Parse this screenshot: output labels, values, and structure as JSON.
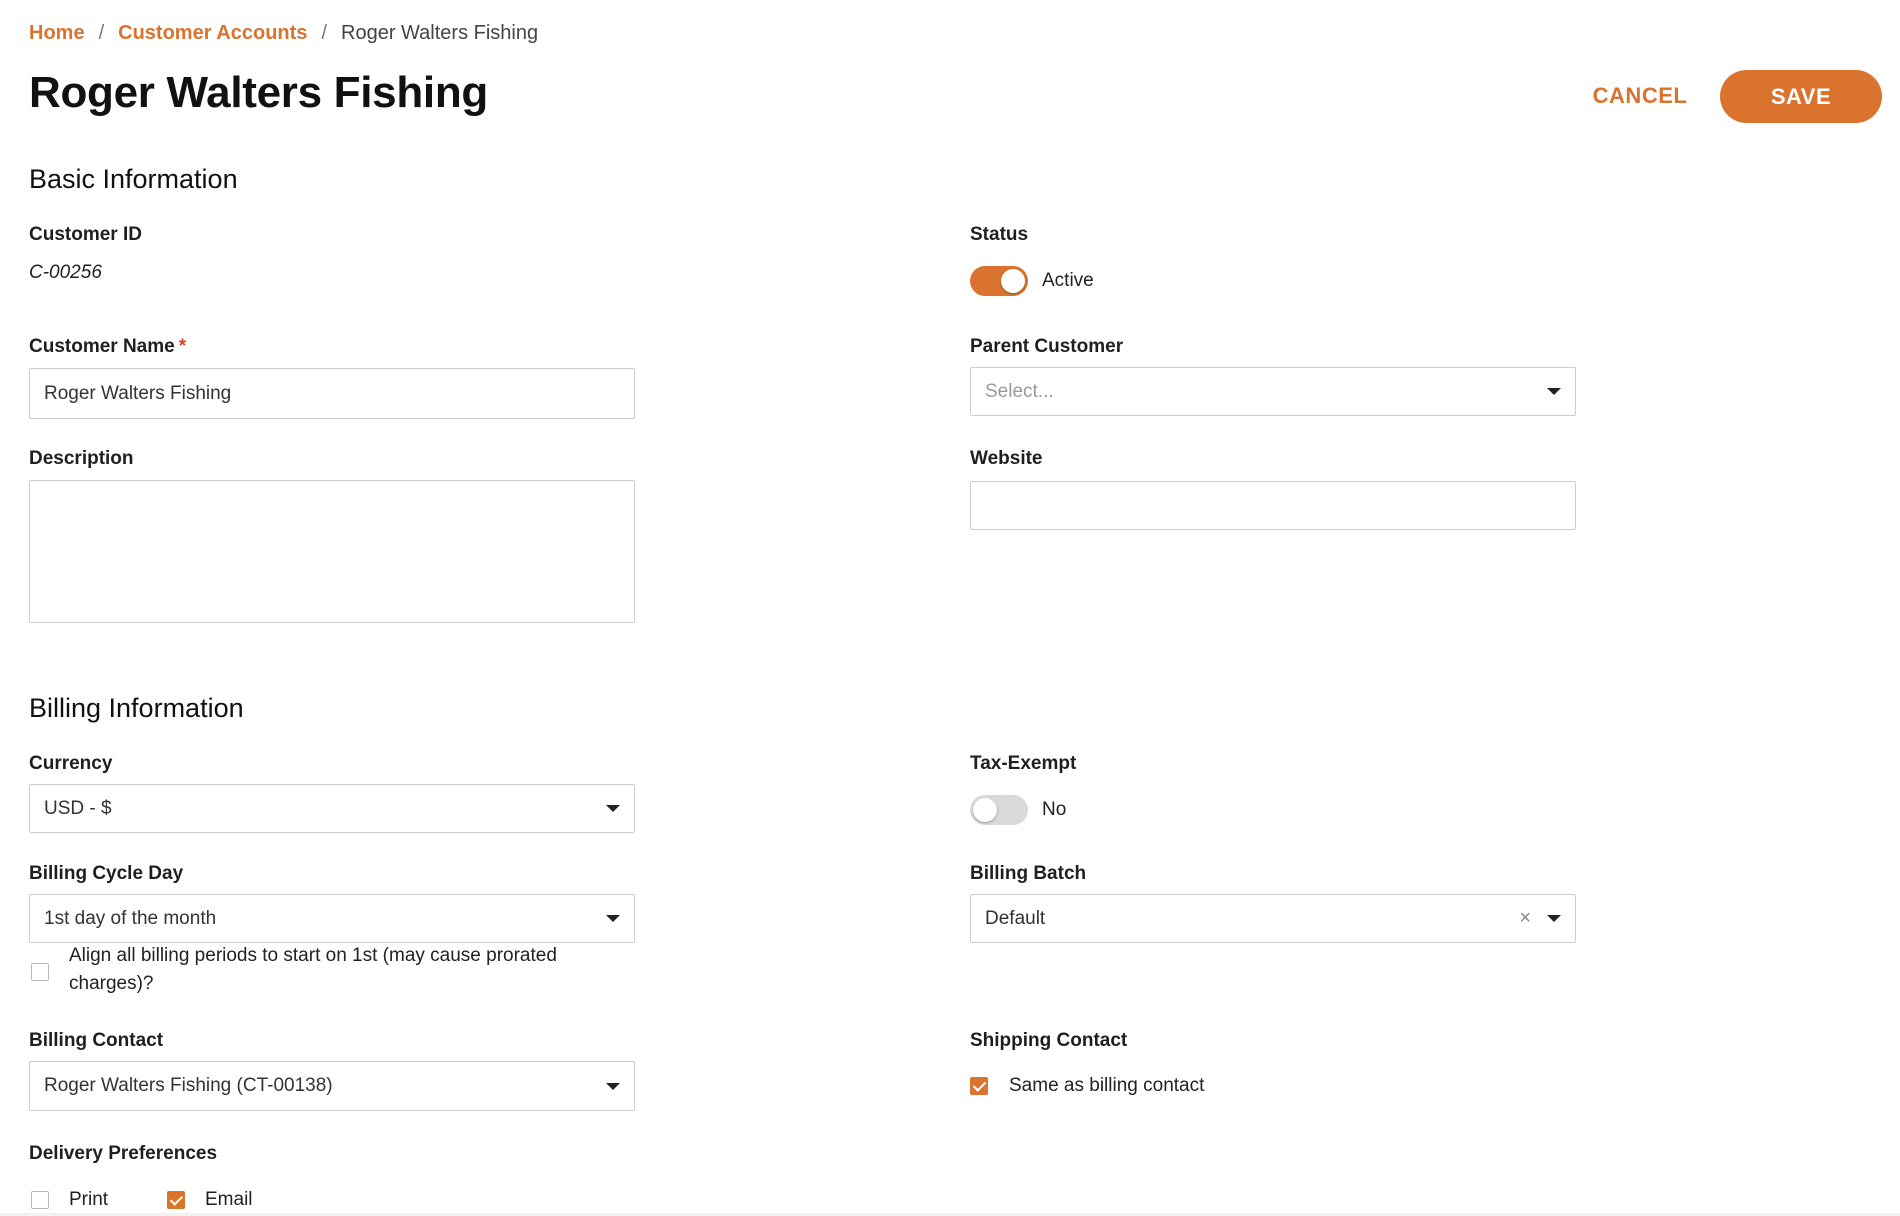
{
  "breadcrumb": {
    "home": "Home",
    "sep": "/",
    "accounts": "Customer Accounts",
    "current": "Roger Walters Fishing"
  },
  "header": {
    "title": "Roger Walters Fishing",
    "cancel_label": "CANCEL",
    "save_label": "SAVE"
  },
  "basic": {
    "section_title": "Basic Information",
    "customer_id_label": "Customer ID",
    "customer_id_value": "C-00256",
    "status_label": "Status",
    "status_value": "Active",
    "customer_name_label": "Customer Name",
    "required_mark": "*",
    "customer_name_value": "Roger Walters Fishing",
    "parent_customer_label": "Parent Customer",
    "parent_customer_placeholder": "Select...",
    "description_label": "Description",
    "description_value": "",
    "website_label": "Website",
    "website_value": ""
  },
  "billing": {
    "section_title": "Billing Information",
    "currency_label": "Currency",
    "currency_value": "USD - $",
    "tax_exempt_label": "Tax-Exempt",
    "tax_exempt_value": "No",
    "cycle_day_label": "Billing Cycle Day",
    "cycle_day_value": "1st day of the month",
    "align_label": "Align all billing periods to start on 1st (may cause prorated charges)?",
    "batch_label": "Billing Batch",
    "batch_value": "Default",
    "billing_contact_label": "Billing Contact",
    "billing_contact_value": "Roger Walters Fishing (CT-00138)",
    "shipping_contact_label": "Shipping Contact",
    "same_as_billing_label": "Same as billing contact",
    "delivery_label": "Delivery Preferences",
    "print_label": "Print",
    "email_label": "Email"
  },
  "colors": {
    "accent": "#d9732e",
    "required": "#d9451f"
  },
  "icons": {
    "caret": "chevron-down-icon",
    "clear": "clear-icon",
    "check": "check-icon"
  }
}
